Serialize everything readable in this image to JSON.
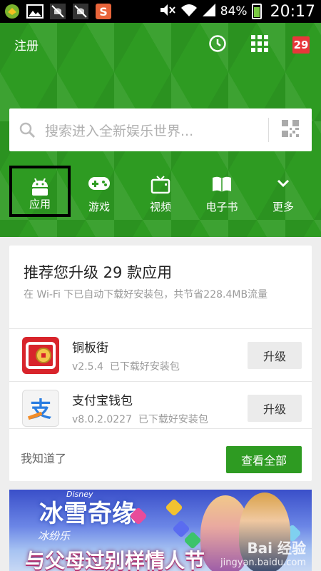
{
  "statusbar": {
    "battery_percent": "84%",
    "time": "20:17",
    "icons": [
      "app-icon",
      "image-icon",
      "notification-off-icon",
      "notification-off-icon",
      "app-s-icon",
      "mute-icon",
      "wifi-icon",
      "signal-icon",
      "battery-icon"
    ]
  },
  "header": {
    "register": "注册",
    "calendar_day": "29",
    "icons": [
      "clock-icon",
      "grid-icon",
      "calendar-icon"
    ],
    "accent_color": "#2e9b22"
  },
  "search": {
    "placeholder": "搜索进入全新娱乐世界..."
  },
  "categories": [
    {
      "label": "应用",
      "icon": "android-icon",
      "selected": true
    },
    {
      "label": "游戏",
      "icon": "gamepad-icon"
    },
    {
      "label": "视频",
      "icon": "tv-icon"
    },
    {
      "label": "电子书",
      "icon": "book-icon"
    },
    {
      "label": "更多",
      "icon": "chevron-down-icon"
    }
  ],
  "upgrade_card": {
    "title": "推荐您升级 29 款应用",
    "subtitle": "在 Wi-Fi 下已自动下载好安装包，共节省228.4MB流量",
    "apps": [
      {
        "name": "铜板街",
        "version": "v2.5.4",
        "status": "已下载好安装包",
        "button": "升级"
      },
      {
        "name": "支付宝钱包",
        "version": "v8.0.2.0227",
        "status": "已下载好安装包",
        "button": "升级"
      }
    ],
    "dismiss": "我知道了",
    "view_all": "查看全部"
  },
  "banner": {
    "logo": "Disney",
    "title": "冰雪奇缘",
    "subtitle": "冰纷乐",
    "headline": "与父母过别样情人节",
    "watermark_line1": "Bai 经验",
    "watermark_line2": "jingyan.baidu.com"
  }
}
